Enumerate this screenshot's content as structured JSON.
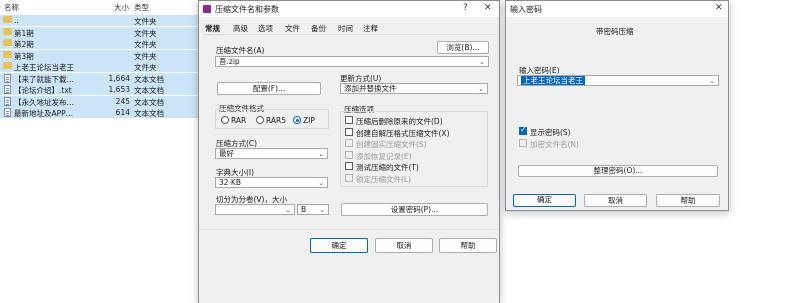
{
  "file_list": {
    "headers": {
      "name": "名称",
      "size": "大小",
      "type": "类型"
    },
    "rows": [
      {
        "name": "..",
        "size": "",
        "type": "文件夹",
        "icon": "folder-icon"
      },
      {
        "name": "第1期",
        "size": "",
        "type": "文件夹",
        "icon": "folder-icon"
      },
      {
        "name": "第2期",
        "size": "",
        "type": "文件夹",
        "icon": "folder-icon"
      },
      {
        "name": "第3期",
        "size": "",
        "type": "文件夹",
        "icon": "folder-icon"
      },
      {
        "name": "上老王论坛当老王",
        "size": "",
        "type": "文件夹",
        "icon": "folder-icon"
      },
      {
        "name": "【来了就能下载…",
        "size": "1,664",
        "type": "文本文档",
        "icon": "text-file-icon"
      },
      {
        "name": "【论坛介绍】.txt",
        "size": "1,653",
        "type": "文本文档",
        "icon": "text-file-icon"
      },
      {
        "name": "【永久地址发布…",
        "size": "245",
        "type": "文本文档",
        "icon": "text-file-icon"
      },
      {
        "name": "最新地址及APP…",
        "size": "614",
        "type": "文本文档",
        "icon": "text-file-icon"
      }
    ]
  },
  "archive_dialog": {
    "title": "压缩文件名和参数",
    "help_btn": "?",
    "close_btn": "✕",
    "tabs": [
      "常规",
      "高级",
      "选项",
      "文件",
      "备份",
      "时间",
      "注释"
    ],
    "archive_name_label": "压缩文件名(A)",
    "archive_name_value": "吾.zip",
    "browse_label": "浏览(B)...",
    "profile_label": "配置(F)...",
    "update_mode_label": "更新方式(U)",
    "update_mode_value": "添加并替换文件",
    "format_label": "压缩文件格式",
    "formats": [
      "RAR",
      "RAR5",
      "ZIP"
    ],
    "selected_format": "ZIP",
    "options_label": "压缩选项",
    "options": [
      {
        "label": "压缩后删除原来的文件(D)",
        "checked": false,
        "disabled": false
      },
      {
        "label": "创建自解压格式压缩文件(X)",
        "checked": false,
        "disabled": false
      },
      {
        "label": "创建固实压缩文件(S)",
        "checked": false,
        "disabled": true
      },
      {
        "label": "添加恢复记录(E)",
        "checked": false,
        "disabled": true
      },
      {
        "label": "测试压缩的文件(T)",
        "checked": false,
        "disabled": false
      },
      {
        "label": "锁定压缩文件(L)",
        "checked": false,
        "disabled": true
      }
    ],
    "method_label": "压缩方式(C)",
    "method_value": "最好",
    "dict_label": "字典大小(I)",
    "dict_value": "32 KB",
    "split_label": "切分为分卷(V)，大小",
    "split_unit": "B",
    "set_password_label": "设置密码(P)...",
    "ok": "确定",
    "cancel": "取消",
    "help": "帮助"
  },
  "password_dialog": {
    "title": "输入密码",
    "close_btn": "✕",
    "heading": "带密码压缩",
    "enter_label": "输入密码(E)",
    "password_value": "上老王论坛当老王",
    "show_password": "显示密码(S)",
    "encrypt_names": "加密文件名(N)",
    "organize": "整理密码(O)...",
    "ok": "确定",
    "cancel": "取消",
    "help": "帮助"
  }
}
